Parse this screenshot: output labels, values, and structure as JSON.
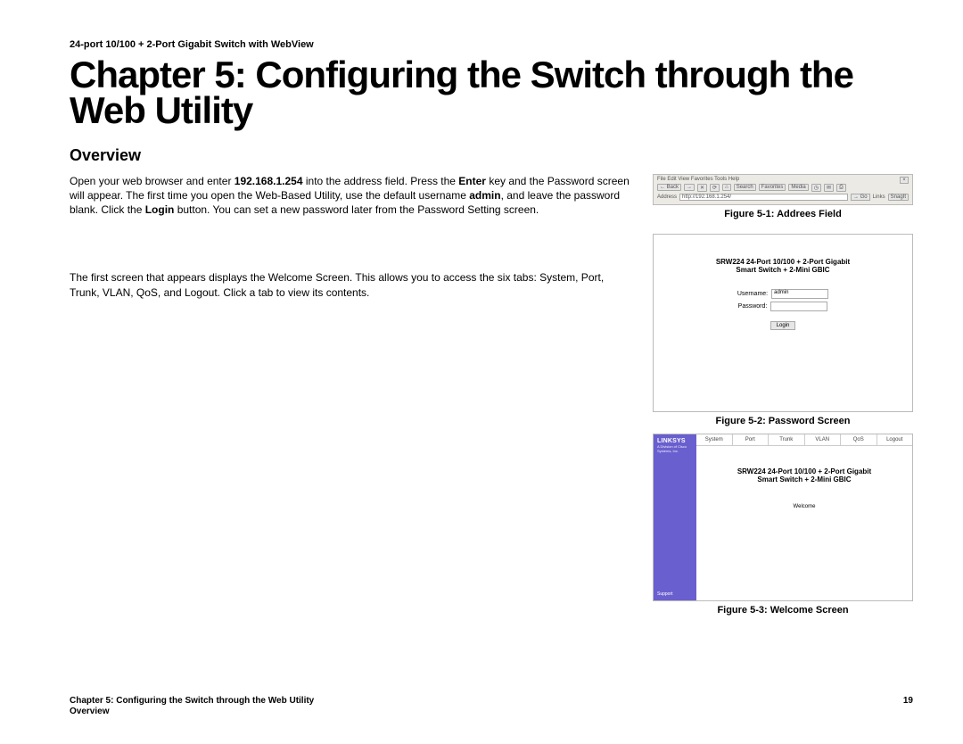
{
  "doc_header": "24-port 10/100 + 2-Port Gigabit Switch with WebView",
  "chapter_title": "Chapter 5: Configuring the Switch through the Web Utility",
  "section_title": "Overview",
  "p1_a": "Open your web browser and enter ",
  "p1_ip": "192.168.1.254",
  "p1_b": " into the address field. Press the ",
  "p1_enter": "Enter",
  "p1_c": " key and the Password screen will appear. The first time you open the Web-Based Utility, use the default username ",
  "p1_admin": "admin",
  "p1_d": ", and leave the password blank. Click the ",
  "p1_login": "Login",
  "p1_e": " button. You can set a new password later from the Password Setting screen.",
  "p2": "The first screen that appears displays the Welcome Screen. This allows you to access the six tabs: System, Port, Trunk, VLAN, QoS, and Logout. Click a tab to view its contents.",
  "fig1": {
    "caption": "Figure 5-1: Addrees Field",
    "menu": "File   Edit   View   Favorites   Tools   Help",
    "back": "← Back",
    "search": "Search",
    "fav": "Favorites",
    "media": "Media",
    "addr_label": "Address",
    "addr_value": "http://192.168.1.254/",
    "go": "→ Go",
    "links": "Links",
    "snagit": "SnagIt"
  },
  "fig2": {
    "caption": "Figure 5-2: Password Screen",
    "title_l1": "SRW224 24-Port 10/100 + 2-Port Gigabit",
    "title_l2": "Smart Switch + 2-Mini GBIC",
    "user_label": "Username:",
    "user_value": "admin",
    "pass_label": "Password:",
    "login": "Login"
  },
  "fig3": {
    "caption": "Figure 5-3: Welcome Screen",
    "logo": "LINKSYS",
    "sublogo": "A Division of Cisco Systems, Inc.",
    "support": "Support",
    "tabs": [
      "System",
      "Port",
      "Trunk",
      "VLAN",
      "QoS",
      "Logout"
    ],
    "title_l1": "SRW224 24-Port 10/100 + 2-Port Gigabit",
    "title_l2": "Smart Switch + 2-Mini GBIC",
    "welcome": "Welcome"
  },
  "footer": {
    "line1": "Chapter 5: Configuring the Switch through the Web Utility",
    "line2": "Overview",
    "page": "19"
  }
}
